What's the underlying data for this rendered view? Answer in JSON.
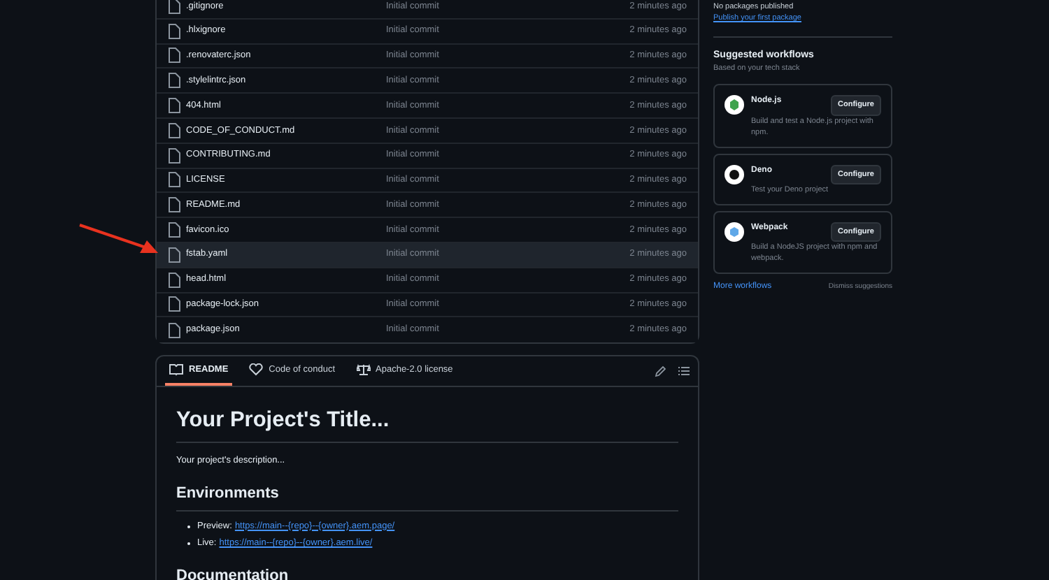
{
  "files": [
    {
      "name": ".gitignore",
      "commit": "Initial commit",
      "time": "2 minutes ago",
      "selected": false
    },
    {
      "name": ".hlxignore",
      "commit": "Initial commit",
      "time": "2 minutes ago",
      "selected": false
    },
    {
      "name": ".renovaterc.json",
      "commit": "Initial commit",
      "time": "2 minutes ago",
      "selected": false
    },
    {
      "name": ".stylelintrc.json",
      "commit": "Initial commit",
      "time": "2 minutes ago",
      "selected": false
    },
    {
      "name": "404.html",
      "commit": "Initial commit",
      "time": "2 minutes ago",
      "selected": false
    },
    {
      "name": "CODE_OF_CONDUCT.md",
      "commit": "Initial commit",
      "time": "2 minutes ago",
      "selected": false
    },
    {
      "name": "CONTRIBUTING.md",
      "commit": "Initial commit",
      "time": "2 minutes ago",
      "selected": false
    },
    {
      "name": "LICENSE",
      "commit": "Initial commit",
      "time": "2 minutes ago",
      "selected": false
    },
    {
      "name": "README.md",
      "commit": "Initial commit",
      "time": "2 minutes ago",
      "selected": false
    },
    {
      "name": "favicon.ico",
      "commit": "Initial commit",
      "time": "2 minutes ago",
      "selected": false
    },
    {
      "name": "fstab.yaml",
      "commit": "Initial commit",
      "time": "2 minutes ago",
      "selected": true
    },
    {
      "name": "head.html",
      "commit": "Initial commit",
      "time": "2 minutes ago",
      "selected": false
    },
    {
      "name": "package-lock.json",
      "commit": "Initial commit",
      "time": "2 minutes ago",
      "selected": false
    },
    {
      "name": "package.json",
      "commit": "Initial commit",
      "time": "2 minutes ago",
      "selected": false
    }
  ],
  "readme": {
    "tabs": [
      {
        "label": "README",
        "kind": "book",
        "selected": true
      },
      {
        "label": "Code of conduct",
        "kind": "heart",
        "selected": false
      },
      {
        "label": "Apache-2.0 license",
        "kind": "scale",
        "selected": false
      }
    ],
    "title": "Your Project's Title...",
    "description": "Your project's description...",
    "sections": [
      {
        "heading": "Environments",
        "items": [
          {
            "label": "Preview:",
            "link": "https://main--{repo}--{owner}.aem.page/"
          },
          {
            "label": "Live:",
            "link": "https://main--{repo}--{owner}.aem.live/"
          }
        ]
      },
      {
        "heading": "Documentation"
      }
    ]
  },
  "sidebar": {
    "packages_note": "No packages published",
    "packages_link": "Publish your first package",
    "workflows_title": "Suggested workflows",
    "workflows_subtitle": "Based on your tech stack",
    "workflows": [
      {
        "name": "Node.js",
        "description": "Build and test a Node.js project with npm.",
        "button": "Configure",
        "kind": "node"
      },
      {
        "name": "Deno",
        "description": "Test your Deno project",
        "button": "Configure",
        "kind": "deno"
      },
      {
        "name": "Webpack",
        "description": "Build a NodeJS project with npm and webpack.",
        "button": "Configure",
        "kind": "webpack"
      }
    ],
    "more_link": "More workflows",
    "dismiss": "Dismiss suggestions"
  }
}
